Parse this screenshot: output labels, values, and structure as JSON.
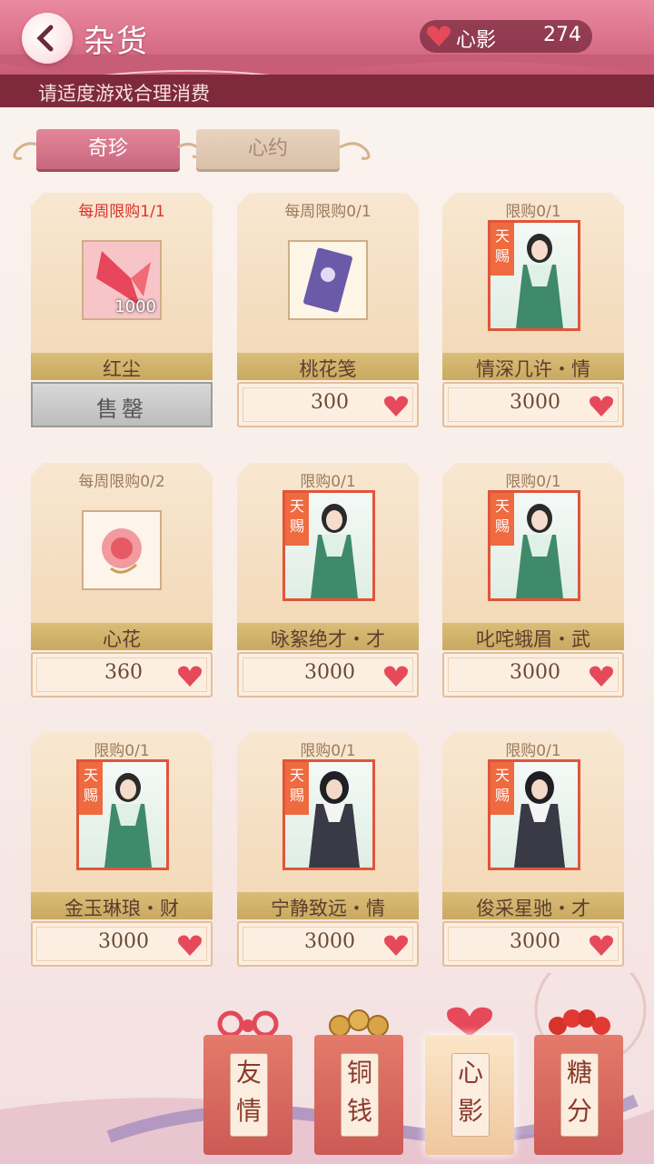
{
  "header": {
    "title": "杂货",
    "currency_name": "心影",
    "currency_value": "274"
  },
  "notice": "请适度游戏合理消费",
  "tabs": [
    {
      "label": "奇珍"
    },
    {
      "label": "心约"
    }
  ],
  "items": [
    {
      "limit": "每周限购1/1",
      "name": "红尘",
      "qty": "1000",
      "soldout_label": "售罄"
    },
    {
      "limit": "每周限购0/1",
      "name": "桃花笺",
      "price": "300"
    },
    {
      "limit": "限购0/1",
      "name": "情深几许・情",
      "price": "3000"
    },
    {
      "limit": "每周限购0/2",
      "name": "心花",
      "price": "360"
    },
    {
      "limit": "限购0/1",
      "name": "咏絮绝才・才",
      "price": "3000"
    },
    {
      "limit": "限购0/1",
      "name": "叱咤蛾眉・武",
      "price": "3000"
    },
    {
      "limit": "限购0/1",
      "name": "金玉琳琅・财",
      "price": "3000"
    },
    {
      "limit": "限购0/1",
      "name": "宁静致远・情",
      "price": "3000"
    },
    {
      "limit": "限购0/1",
      "name": "俊采星驰・才",
      "price": "3000"
    }
  ],
  "portrait_badge": "天赐",
  "shop_bags": [
    {
      "label": "友情"
    },
    {
      "label": "铜钱"
    },
    {
      "label": "心影"
    },
    {
      "label": "糖分"
    }
  ]
}
